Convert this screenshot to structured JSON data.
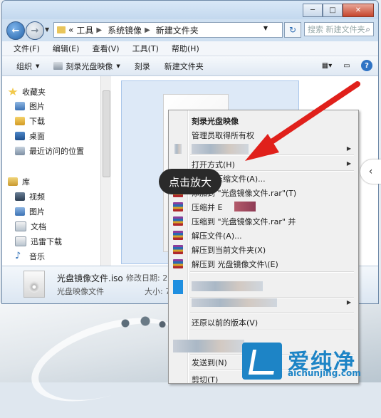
{
  "window": {
    "controls": {
      "minimize": "─",
      "maximize": "□",
      "close": "✕"
    }
  },
  "address": {
    "back_glyph": "←",
    "forward_glyph": "→",
    "overflow": "«",
    "crumbs": [
      "工具",
      "系统镜像",
      "新建文件夹"
    ],
    "search_placeholder": "搜索 新建文件夹",
    "refresh_glyph": "↻"
  },
  "menubar": [
    "文件(F)",
    "编辑(E)",
    "查看(V)",
    "工具(T)",
    "帮助(H)"
  ],
  "toolbar": {
    "organize": "组织",
    "burn_image": "刻录光盘映像",
    "burn": "刻录",
    "new_folder": "新建文件夹",
    "help_glyph": "?"
  },
  "nav": {
    "favorites": "收藏夹",
    "favorites_items": [
      "图片",
      "下载",
      "桌面",
      "最近访问的位置"
    ],
    "libraries": "库",
    "library_items": [
      "视频",
      "图片",
      "文档",
      "迅雷下载",
      "音乐"
    ]
  },
  "status": {
    "filename": "光盘镜像文件.iso",
    "date_label": "修改日期: 20",
    "type": "光盘映像文件",
    "size_label": "大小: 72"
  },
  "context_menu": {
    "burn": "刻录光盘映像",
    "take_ownership": "管理员取得所有权",
    "open_with": "打开方式(H)",
    "add_archive": "添加到压缩文件(A)...",
    "add_to_rar": "添加到 \"光盘镜像文件.rar\"(T)",
    "compress_email": "压缩并 E",
    "compress_to_rar_email": "压缩到 \"光盘镜像文件.rar\" 并",
    "extract": "解压文件(A)...",
    "extract_here": "解压到当前文件夹(X)",
    "extract_to_folder": "解压到 光盘镜像文件\\(E)",
    "restore": "还原以前的版本(V)",
    "send_to": "发送到(N)",
    "cut": "剪切(T)"
  },
  "overlay": {
    "zoom_label": "点击放大",
    "right_chevron": "‹"
  },
  "watermark": {
    "name": "爱纯净",
    "url": "aichunjing.com"
  },
  "colors": {
    "arrow": "#e0201b",
    "brand": "#1d84c6"
  }
}
